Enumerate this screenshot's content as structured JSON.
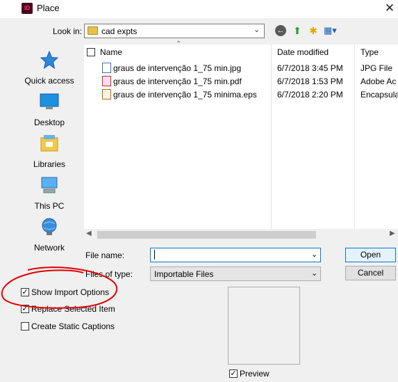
{
  "window": {
    "title": "Place",
    "app_icon": "ID"
  },
  "lookin": {
    "label": "Look in:",
    "value": "cad expts"
  },
  "places": [
    {
      "label": "Quick access",
      "icon": "star-icon"
    },
    {
      "label": "Desktop",
      "icon": "desktop-icon"
    },
    {
      "label": "Libraries",
      "icon": "libraries-icon"
    },
    {
      "label": "This PC",
      "icon": "computer-icon"
    },
    {
      "label": "Network",
      "icon": "network-icon"
    }
  ],
  "columns": {
    "name": "Name",
    "date": "Date modified",
    "type": "Type"
  },
  "files": [
    {
      "name": "graus de intervenção 1_75 min.jpg",
      "date": "6/7/2018 3:45 PM",
      "type": "JPG File",
      "icon": "image-file-icon"
    },
    {
      "name": "graus de intervenção 1_75 min.pdf",
      "date": "6/7/2018 1:53 PM",
      "type": "Adobe Ac",
      "icon": "pdf-file-icon"
    },
    {
      "name": "graus de intervenção 1_75 minima.eps",
      "date": "6/7/2018 2:20 PM",
      "type": "Encapsula",
      "icon": "eps-file-icon"
    }
  ],
  "filename": {
    "label": "File name:",
    "value": ""
  },
  "filetype": {
    "label": "Files of type:",
    "value": "Importable Files"
  },
  "buttons": {
    "open": "Open",
    "cancel": "Cancel"
  },
  "options": {
    "show_import": {
      "label": "Show Import Options",
      "checked": true
    },
    "replace_selected": {
      "label": "Replace Selected Item",
      "checked": true
    },
    "static_captions": {
      "label": "Create Static Captions",
      "checked": false
    }
  },
  "preview": {
    "label": "Preview",
    "checked": true
  },
  "colors": {
    "accent": "#0078d7",
    "annotation": "#e00000"
  }
}
